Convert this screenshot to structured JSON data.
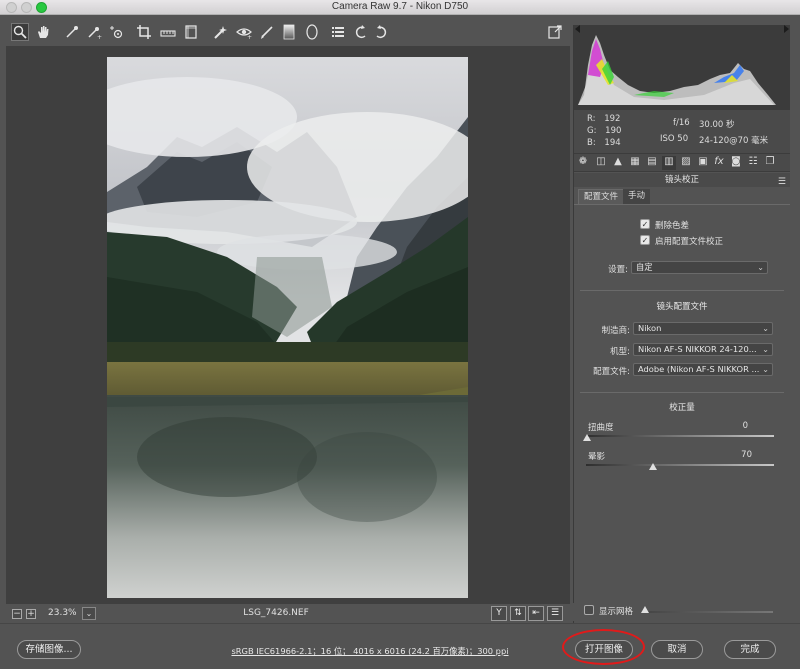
{
  "window": {
    "title": "Camera Raw 9.7 -  Nikon D750"
  },
  "toolbar": {
    "tools": [
      "zoom-tool",
      "hand-tool",
      "white-balance-tool",
      "color-sampler-tool",
      "targeted-adjustment-tool",
      "crop-tool",
      "straighten-tool",
      "transform-tool",
      "spot-removal-tool",
      "red-eye-removal-tool",
      "adjustment-brush",
      "graduated-filter",
      "radial-filter",
      "preferences",
      "rotate-left",
      "rotate-right",
      "fullscreen-toggle"
    ]
  },
  "canvas": {
    "zoom_level": "23.3%",
    "filename": "LSG_7426.NEF",
    "zoom_minus": "−",
    "zoom_plus": "+",
    "zoom_dropdown": "⌄",
    "view_y": "Y"
  },
  "histogram": {
    "rgb": {
      "r_label": "R:",
      "r": "192",
      "g_label": "G:",
      "g": "190",
      "b_label": "B:",
      "b": "194"
    },
    "aperture": "f/16",
    "shutter": "30.00 秒",
    "iso": "ISO 50",
    "lens": "24-120@70 毫米"
  },
  "panel": {
    "title": "镜头校正",
    "subtabs": [
      "配置文件",
      "手动"
    ],
    "remove_ca_label": "删除色差",
    "remove_ca_checked": true,
    "enable_profile_label": "启用配置文件校正",
    "enable_profile_checked": true,
    "setup_label": "设置:",
    "setup_value": "自定",
    "profile_section_title": "镜头配置文件",
    "make_label": "制造商:",
    "make_value": "Nikon",
    "model_label": "机型:",
    "model_value": "Nikon AF-S NIKKOR 24-120...",
    "profile_label": "配置文件:",
    "profile_value": "Adobe (Nikon AF-S NIKKOR ...",
    "amount_section_title": "校正量",
    "distortion_label": "扭曲度",
    "distortion_value": "0",
    "distortion_level": 0,
    "vignetting_label": "晕影",
    "vignetting_value": "70",
    "vignetting_level": 0.35,
    "show_grid_label": "显示网格",
    "show_grid_checked": false
  },
  "bottom": {
    "save_button": "存储图像...",
    "workflow_link": "sRGB IEC61966-2.1；16 位；  4016 x 6016 (24.2 百万像素)；300 ppi",
    "open_button": "打开图像",
    "cancel_button": "取消",
    "done_button": "完成"
  },
  "colors": {
    "background": "#535353",
    "canvas": "#3f3f3f",
    "highlight_ring": "#e11a1a"
  }
}
